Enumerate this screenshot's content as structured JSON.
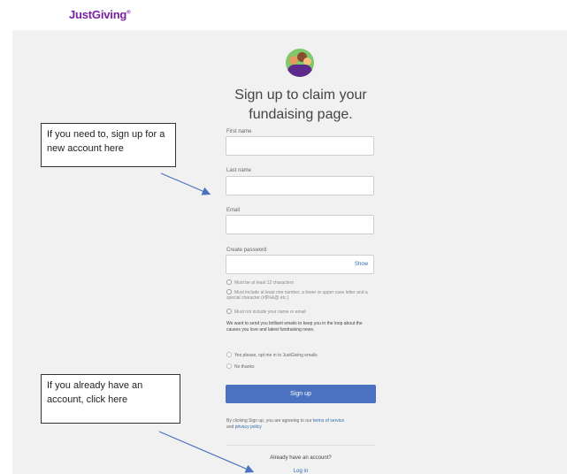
{
  "header": {
    "logo": "JustGiving"
  },
  "form": {
    "title": "Sign up to claim your fundaising page.",
    "first_name_label": "First name",
    "last_name_label": "Last name",
    "email_label": "Email",
    "password_label": "Create password",
    "show_label": "Show",
    "rules": [
      "Must be at least 12 characters",
      "Must include at least one number, a lower or upper case letter and a special character (#$%&@ etc.)",
      "Must not include your name or email"
    ],
    "emails_text": "We want to send you brilliant emails to keep you in the loop about the causes you love and latest fundraising news.",
    "option_yes": "Yes please, opt me in to JustGiving emails",
    "option_no": "No thanks",
    "signup_label": "Sign up",
    "terms_prefix": "By clicking Sign up, you are agreeing to our",
    "terms_link": "terms of service",
    "terms_and": "and",
    "privacy_link": "privacy policy",
    "already_text": "Already have an account?",
    "login_label": "Log in"
  },
  "annotations": {
    "callout_signup": "If you need to, sign up for a new account here",
    "callout_login": "If you already have an account, click here"
  },
  "colors": {
    "brand": "#7a1fa2",
    "button": "#4a72c0",
    "link": "#2b6cb0"
  }
}
